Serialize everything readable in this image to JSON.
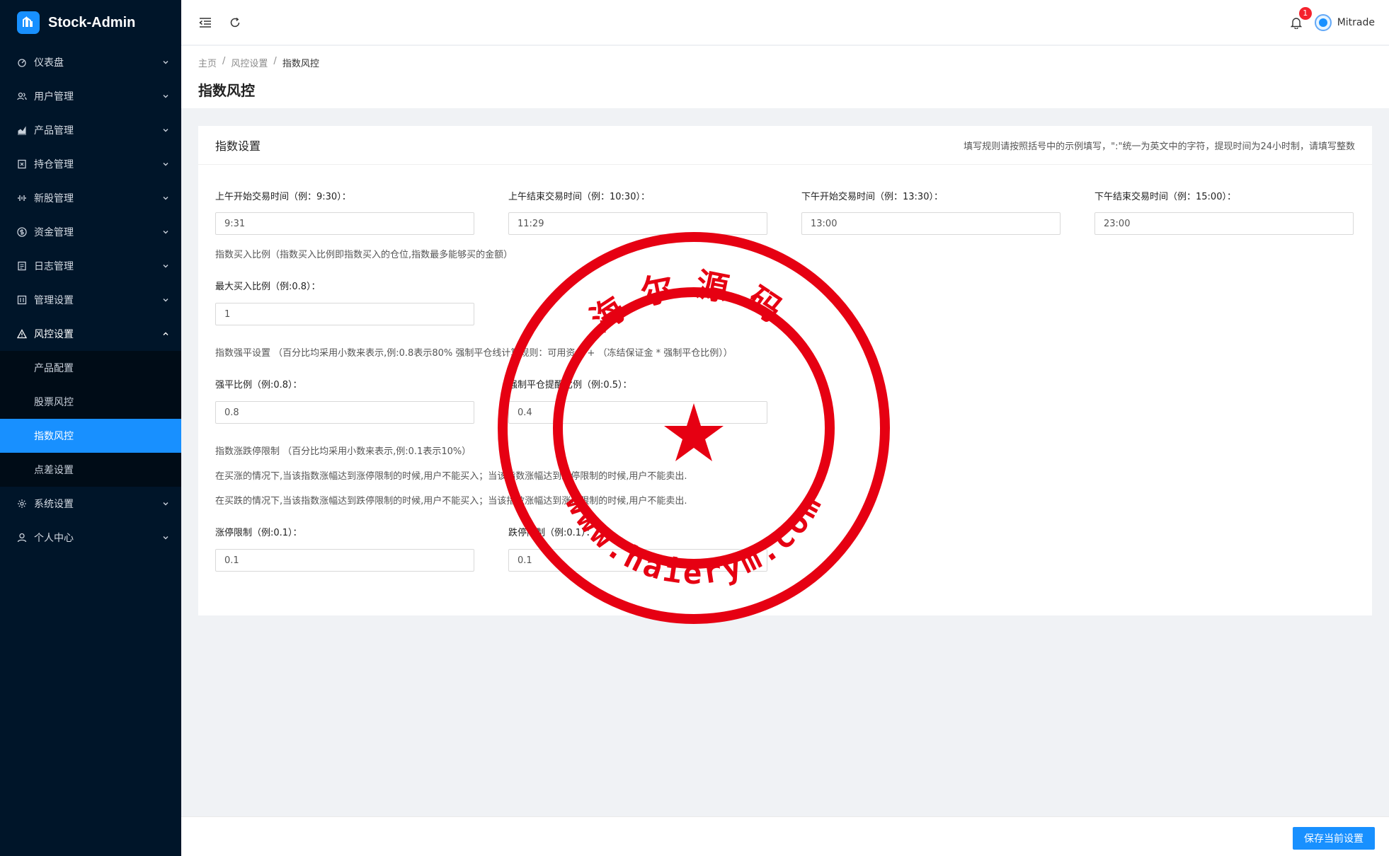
{
  "brand": {
    "title": "Stock-Admin"
  },
  "sidebar": {
    "items": [
      {
        "label": "仪表盘",
        "icon": "dashboard-icon"
      },
      {
        "label": "用户管理",
        "icon": "user-group-icon"
      },
      {
        "label": "产品管理",
        "icon": "chart-icon"
      },
      {
        "label": "持仓管理",
        "icon": "position-icon"
      },
      {
        "label": "新股管理",
        "icon": "ipo-icon"
      },
      {
        "label": "资金管理",
        "icon": "money-icon"
      },
      {
        "label": "日志管理",
        "icon": "log-icon"
      },
      {
        "label": "管理设置",
        "icon": "admin-settings-icon"
      },
      {
        "label": "风控设置",
        "icon": "warning-icon"
      },
      {
        "label": "系统设置",
        "icon": "gear-icon"
      },
      {
        "label": "个人中心",
        "icon": "user-icon"
      }
    ],
    "risk_submenu": [
      {
        "label": "产品配置"
      },
      {
        "label": "股票风控"
      },
      {
        "label": "指数风控"
      },
      {
        "label": "点差设置"
      }
    ]
  },
  "header": {
    "notification_count": "1",
    "user_name": "Mitrade"
  },
  "breadcrumb": {
    "home": "主页",
    "parent": "风控设置",
    "current": "指数风控",
    "sep": "/"
  },
  "page": {
    "title": "指数风控"
  },
  "card": {
    "title": "指数设置",
    "hint": "填写规则请按照括号中的示例填写，\":\"统一为英文中的字符，提现时间为24小时制，请填写整数"
  },
  "form": {
    "am_start_label": "上午开始交易时间（例：9:30）：",
    "am_start_value": "9:31",
    "am_end_label": "上午结束交易时间（例：10:30）：",
    "am_end_value": "11:29",
    "pm_start_label": "下午开始交易时间（例：13:30）：",
    "pm_start_value": "13:00",
    "pm_end_label": "下午结束交易时间（例：15:00）：",
    "pm_end_value": "23:00",
    "buy_ratio_note": "指数买入比例（指数买入比例即指数买入的仓位,指数最多能够买的金额）",
    "max_buy_label": "最大买入比例（例:0.8）：",
    "max_buy_value": "1",
    "force_note": "指数强平设置 （百分比均采用小数来表示,例:0.8表示80% 强制平仓线计算规则：可用资金 + （冻结保证金 * 强制平仓比例））",
    "force_ratio_label": "强平比例（例:0.8）：",
    "force_ratio_value": "0.8",
    "force_warn_label": "强制平仓提醒比例（例:0.5）：",
    "force_warn_value": "0.4",
    "limit_note": "指数涨跌停限制 （百分比均采用小数来表示,例:0.1表示10%）",
    "limit_note_up": "在买涨的情况下,当该指数涨幅达到涨停限制的时候,用户不能买入；当该指数涨幅达到跌停限制的时候,用户不能卖出.",
    "limit_note_down": "在买跌的情况下,当该指数涨幅达到跌停限制的时候,用户不能买入；当该指数涨幅达到涨停限制的时候,用户不能卖出.",
    "rise_limit_label": "涨停限制（例:0.1）：",
    "rise_limit_value": "0.1",
    "fall_limit_label": "跌停限制（例:0.1）：",
    "fall_limit_value": "0.1"
  },
  "footer": {
    "save_label": "保存当前设置"
  },
  "watermark": {
    "top_text": "海尔源码",
    "bottom_text": "www.haierym.com",
    "color": "#e60012"
  }
}
